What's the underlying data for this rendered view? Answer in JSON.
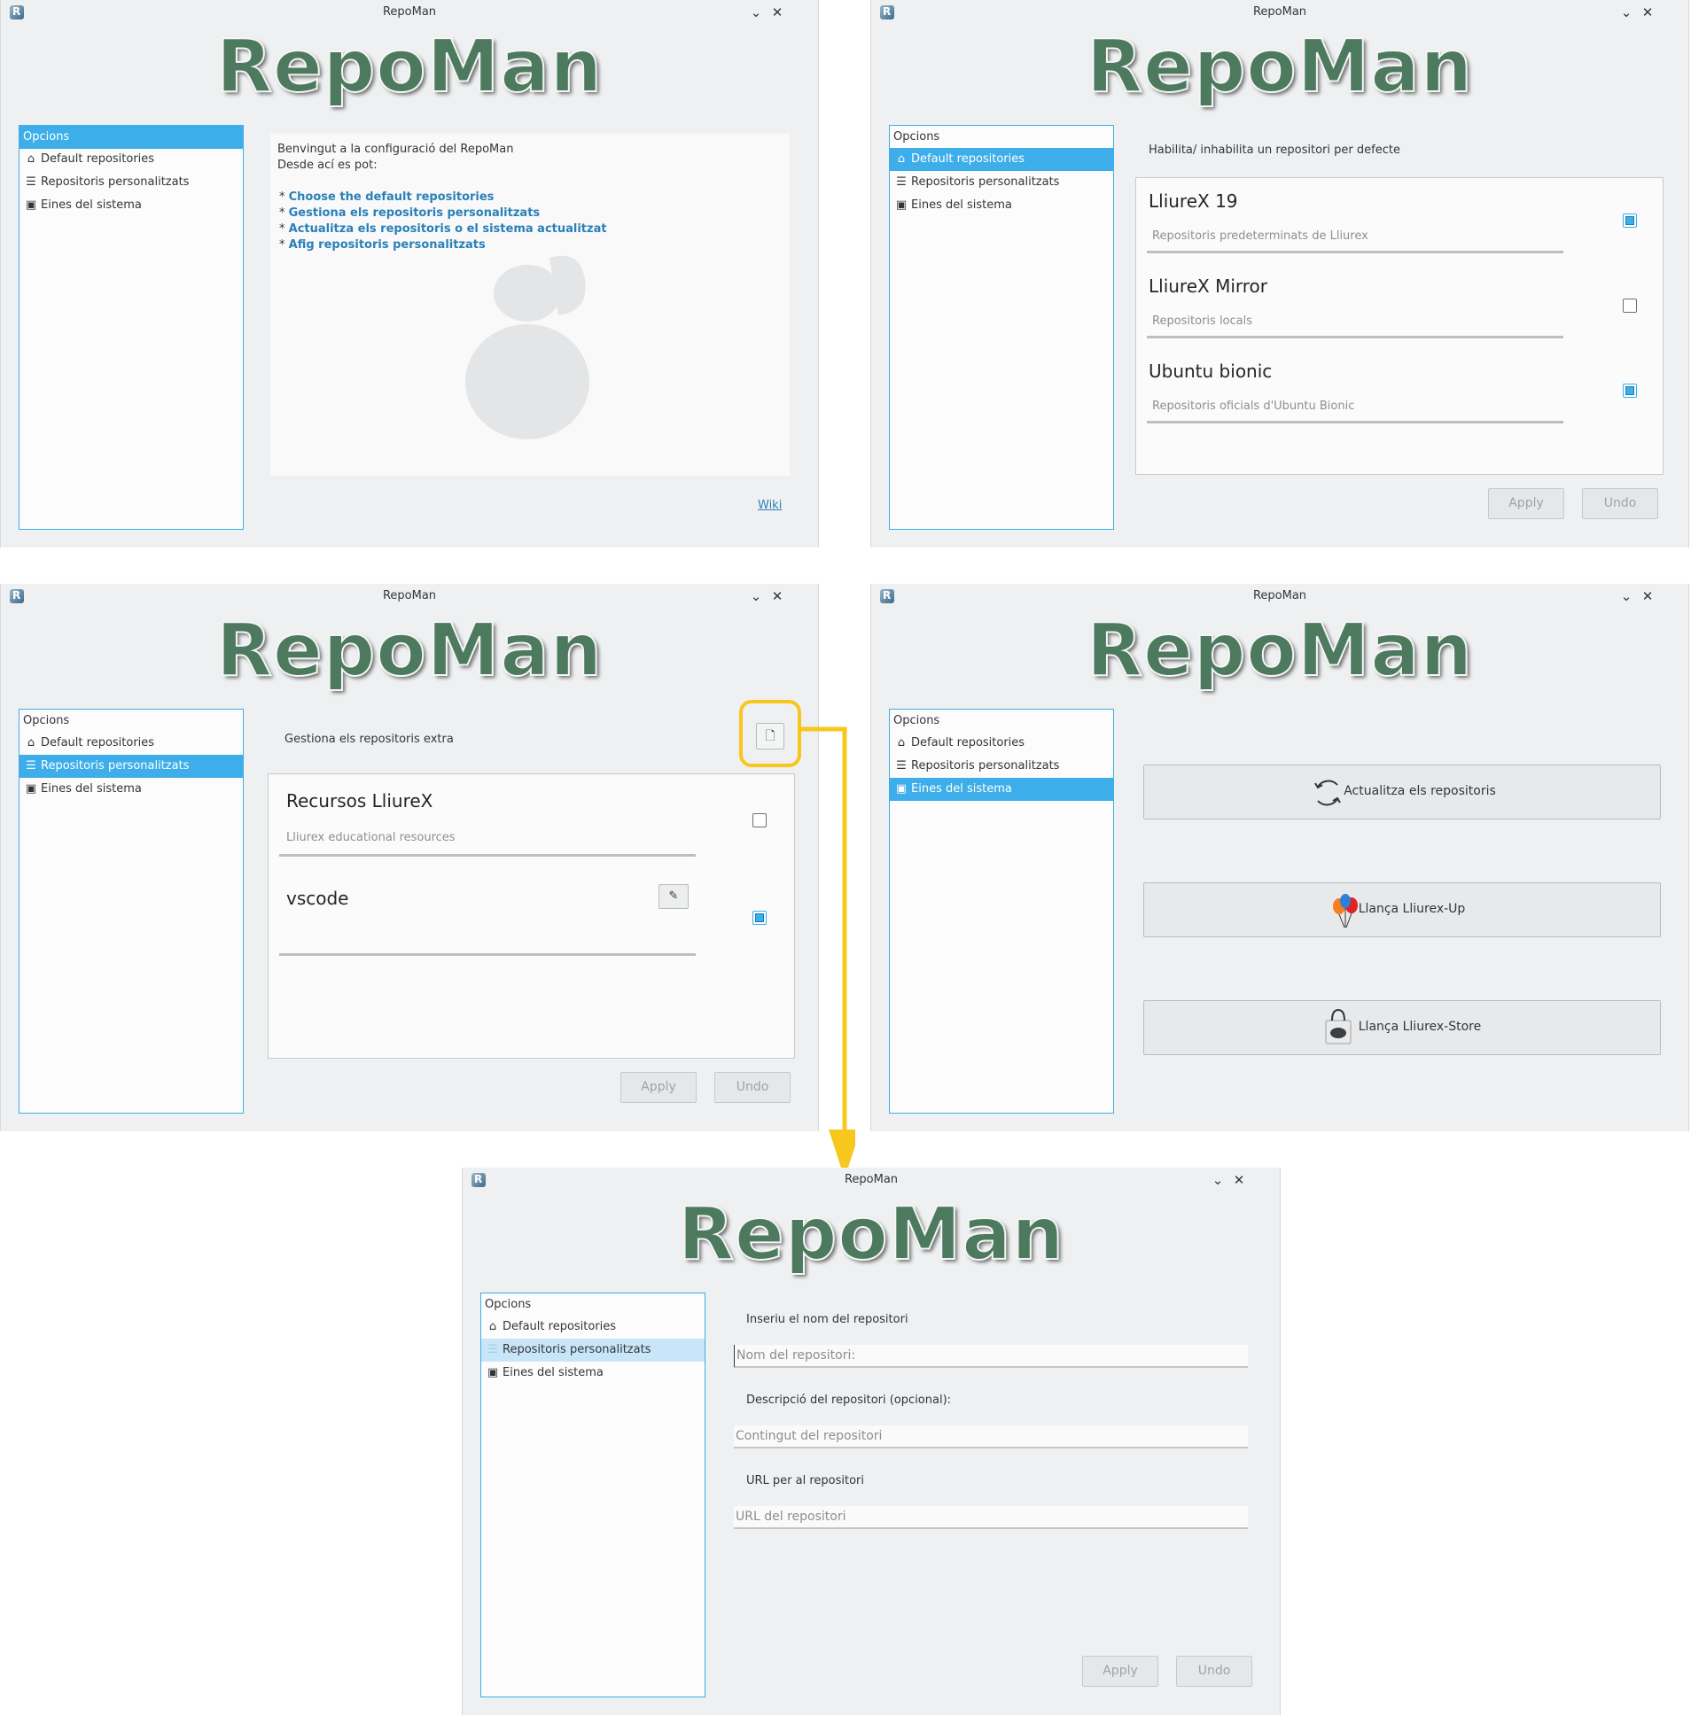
{
  "window": {
    "title": "RepoMan",
    "logo_text": "RepoMan",
    "minimize_glyph": "⌄",
    "close_glyph": "✕"
  },
  "sidebar": {
    "header": "Opcions",
    "items": [
      {
        "label": "Default repositories",
        "icon": "home-icon"
      },
      {
        "label": "Repositoris personalitzats",
        "icon": "list-icon"
      },
      {
        "label": "Eines del sistema",
        "icon": "system-tools-icon"
      }
    ]
  },
  "welcome": {
    "line1": "Benvingut a la configuració del RepoMan",
    "line2": "Desde ací es pot:",
    "bullet": "*",
    "links": [
      "Choose the default repositories",
      "Gestiona els repositoris personalitzats",
      "Actualitza els repositoris o el sistema actualitzat",
      "Afig repositoris personalitzats"
    ],
    "wiki": "Wiki"
  },
  "defaults": {
    "heading": "Habilita/ inhabilita un repositori per defecte",
    "repos": [
      {
        "name": "LliureX 19",
        "desc": "Repositoris predeterminats de Lliurex",
        "checked": true
      },
      {
        "name": "LliureX Mirror",
        "desc": "Repositoris locals",
        "checked": false
      },
      {
        "name": "Ubuntu bionic",
        "desc": "Repositoris oficials d'Ubuntu Bionic",
        "checked": true
      }
    ]
  },
  "custom": {
    "heading": "Gestiona els repositoris extra",
    "repos": [
      {
        "name": "Recursos LliureX",
        "desc": "Lliurex educational resources",
        "checked": false
      },
      {
        "name": "vscode",
        "desc": "",
        "checked": true
      }
    ]
  },
  "tools": {
    "update": "Actualitza els repositoris",
    "lliurex_up": "Llança Lliurex-Up",
    "lliurex_store": "Llança Lliurex-Store"
  },
  "add_form": {
    "name_label": "Inseriu el nom del repositori",
    "name_placeholder": "Nom del repositori:",
    "desc_label": "Descripció del repositori (opcional):",
    "desc_placeholder": "Contingut del repositori",
    "url_label": "URL per al repositori",
    "url_placeholder": "URL del repositori"
  },
  "buttons": {
    "apply": "Apply",
    "undo": "Undo"
  },
  "colors": {
    "accent": "#3daee9",
    "highlight": "#f7c71d",
    "logo": "#4d7a5e",
    "link": "#2980b9"
  }
}
